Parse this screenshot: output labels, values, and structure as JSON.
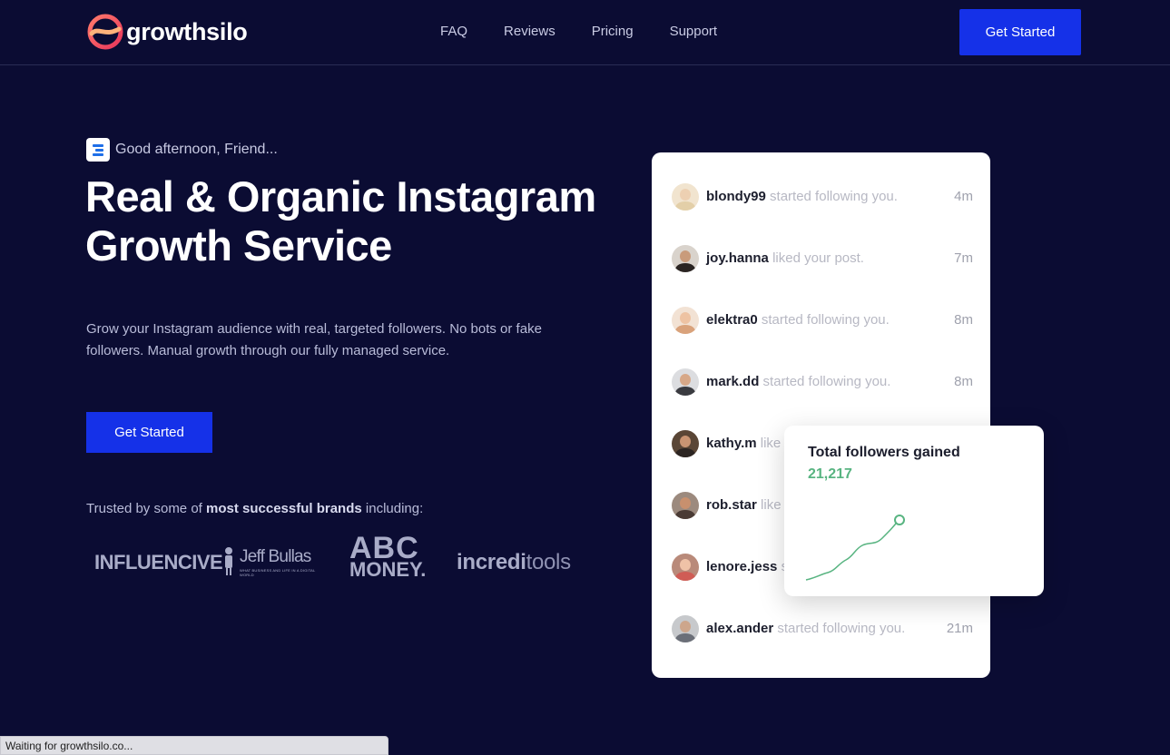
{
  "nav": {
    "logo_text": "growthsilo",
    "links": [
      "FAQ",
      "Reviews",
      "Pricing",
      "Support"
    ],
    "cta": "Get Started"
  },
  "hero": {
    "greeting": "Good afternoon, Friend...",
    "headline_line1": "Real & Organic Instagram",
    "headline_line2": "Growth Service",
    "subtext": "Grow your Instagram audience with real, targeted followers. No bots or fake followers. Manual growth through our fully managed service.",
    "cta": "Get Started",
    "trusted_prefix": "Trusted by some of ",
    "trusted_bold": "most successful brands",
    "trusted_suffix": " including:"
  },
  "brands": {
    "influencive": "INFLUENCIVE",
    "jeff_bullas": "Jeff Bullas",
    "jeff_bullas_tag": "WHAT BUSINESS AND LIFE IN A DIGITAL WORLD",
    "abc_line1": "ABC",
    "abc_line2": "MONEY.",
    "increditools_a": "incredi",
    "increditools_b": "tools"
  },
  "activity": [
    {
      "user": "blondy99",
      "action": "started following you.",
      "time": "4m"
    },
    {
      "user": "joy.hanna",
      "action": "liked your post.",
      "time": "7m"
    },
    {
      "user": "elektra0",
      "action": "started following you.",
      "time": "8m"
    },
    {
      "user": "mark.dd",
      "action": "started following you.",
      "time": "8m"
    },
    {
      "user": "kathy.m",
      "action": "like",
      "time": ""
    },
    {
      "user": "rob.star",
      "action": "like",
      "time": ""
    },
    {
      "user": "lenore.jess",
      "action": "s",
      "time": ""
    },
    {
      "user": "alex.ander",
      "action": "started following you.",
      "time": "21m"
    }
  ],
  "followers_card": {
    "title": "Total followers gained",
    "value": "21,217"
  },
  "status_bar": "Waiting for growthsilo.co...",
  "colors": {
    "background": "#0b0c33",
    "accent": "#1531e8",
    "growth_green": "#58b481"
  }
}
